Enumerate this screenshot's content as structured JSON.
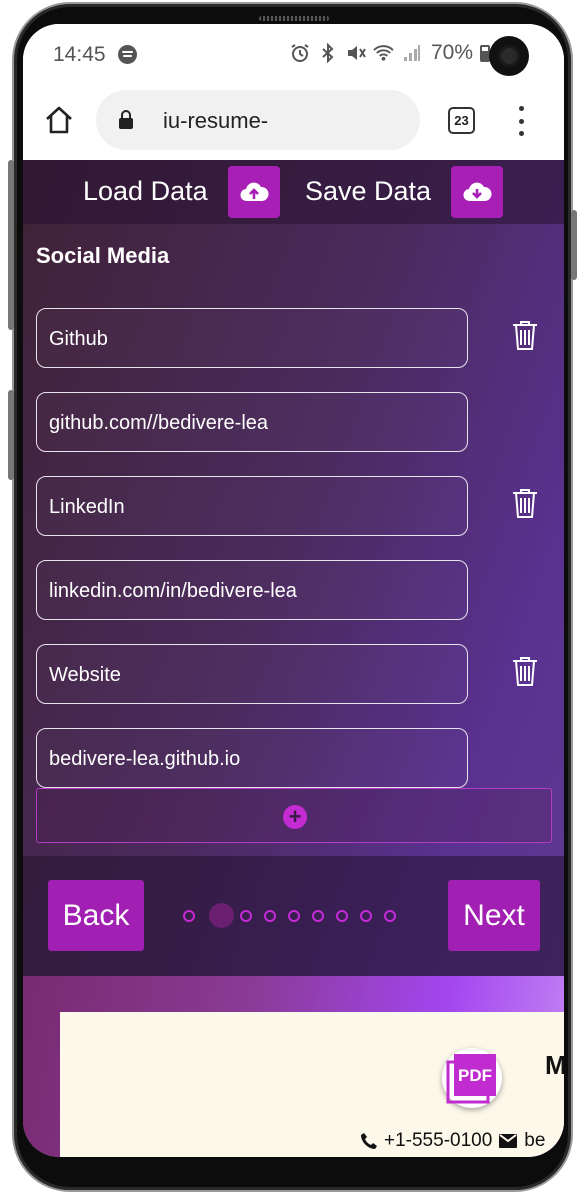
{
  "status_bar": {
    "time": "14:45",
    "battery": "70%"
  },
  "browser": {
    "url": "iu-resume-",
    "tab_count": "23"
  },
  "toolbar": {
    "load_label": "Load Data",
    "save_label": "Save Data"
  },
  "section": {
    "title": "Social Media"
  },
  "social": [
    {
      "name": "Github",
      "url": "github.com//bedivere-lea"
    },
    {
      "name": "LinkedIn",
      "url": "linkedin.com/in/bedivere-lea"
    },
    {
      "name": "Website",
      "url": "bedivere-lea.github.io"
    }
  ],
  "add_button": {
    "label": "+"
  },
  "nav": {
    "back_label": "Back",
    "next_label": "Next",
    "step_count": 9,
    "current_step": 2
  },
  "preview": {
    "name_fragment": "M",
    "phone": "+1-555-0100",
    "email_fragment": "be"
  },
  "fab": {
    "label": "PDF"
  },
  "colors": {
    "accent": "#a81fb5",
    "dot": "#c62ad6",
    "paper": "#fcf8ea"
  }
}
